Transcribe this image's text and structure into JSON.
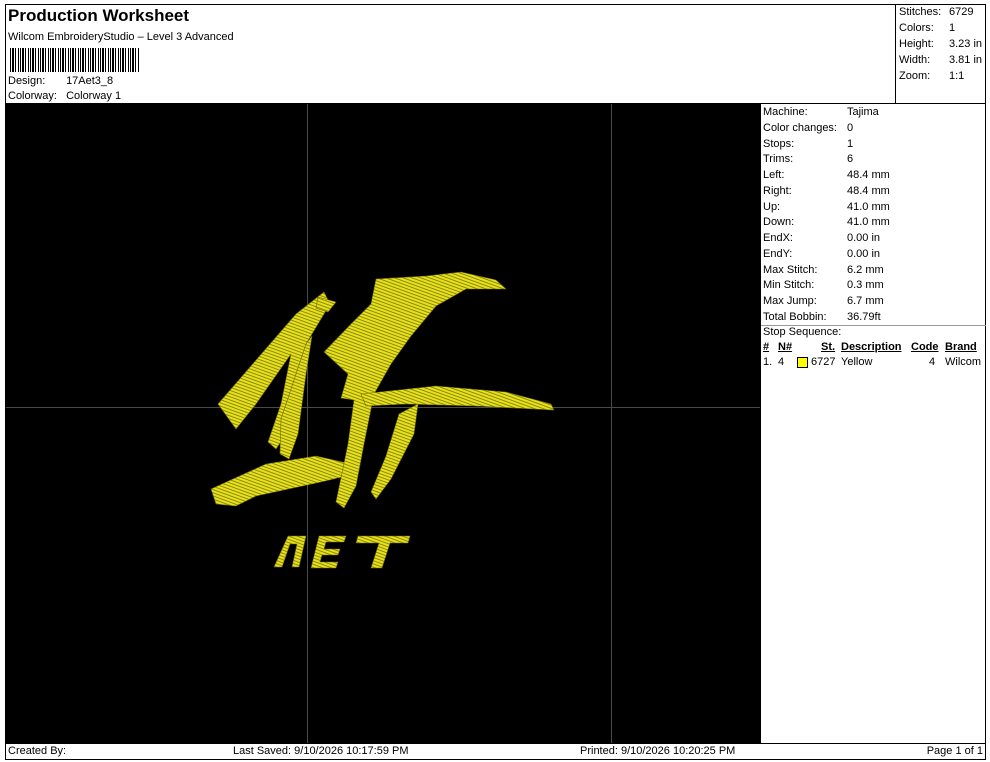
{
  "header": {
    "title": "Production Worksheet",
    "subtitle": "Wilcom EmbroideryStudio – Level 3 Advanced",
    "design_label": "Design:",
    "design_value": "17Aet3_8",
    "colorway_label": "Colorway:",
    "colorway_value": "Colorway 1"
  },
  "stats": [
    {
      "label": "Stitches:",
      "value": "6729"
    },
    {
      "label": "Colors:",
      "value": "1"
    },
    {
      "label": "Height:",
      "value": "3.23 in"
    },
    {
      "label": "Width:",
      "value": "3.81 in"
    },
    {
      "label": "Zoom:",
      "value": "1:1"
    }
  ],
  "machine_info": [
    {
      "label": "Machine:",
      "value": "Tajima"
    },
    {
      "label": "Color changes:",
      "value": "0"
    },
    {
      "label": "Stops:",
      "value": "1"
    },
    {
      "label": "Trims:",
      "value": "6"
    },
    {
      "label": "Left:",
      "value": "48.4 mm"
    },
    {
      "label": "Right:",
      "value": "48.4 mm"
    },
    {
      "label": "Up:",
      "value": "41.0 mm"
    },
    {
      "label": "Down:",
      "value": "41.0 mm"
    },
    {
      "label": "EndX:",
      "value": "0.00 in"
    },
    {
      "label": "EndY:",
      "value": "0.00 in"
    },
    {
      "label": "Max Stitch:",
      "value": "6.2 mm"
    },
    {
      "label": "Min Stitch:",
      "value": "0.3 mm"
    },
    {
      "label": "Max Jump:",
      "value": "6.7 mm"
    },
    {
      "label": "Total Bobbin:",
      "value": "36.79ft"
    }
  ],
  "stop_sequence": {
    "title": "Stop Sequence:",
    "headers": {
      "num": "#",
      "n": "N#",
      "st": "St.",
      "description": "Description",
      "code": "Code",
      "brand": "Brand"
    },
    "rows": [
      {
        "num": "1.",
        "n": "4",
        "st": "6727",
        "description": "Yellow",
        "code": "4",
        "brand": "Wilcom",
        "color": "#ffff00"
      }
    ]
  },
  "design_art": {
    "main_text": "17",
    "sub_text": "ЛЕТ",
    "thread_color": "#e8e21a"
  },
  "footer": {
    "created": "Created By:",
    "saved": "Last Saved: 9/10/2026 10:17:59 PM",
    "printed": "Printed: 9/10/2026 10:20:25 PM",
    "page": "Page 1 of 1"
  }
}
